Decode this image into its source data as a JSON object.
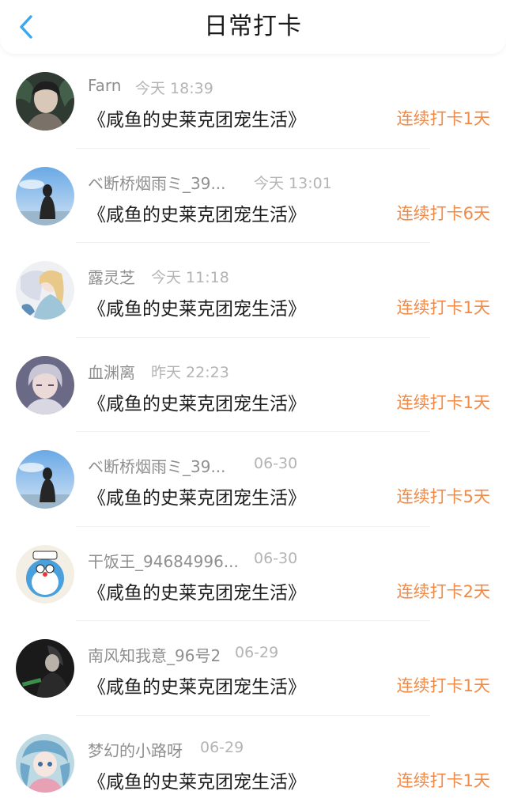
{
  "header": {
    "title": "日常打卡",
    "back_icon": "chevron-left-icon",
    "accent_color": "#3aa8ee"
  },
  "colors": {
    "streak": "#f08a46",
    "name": "#8f8f8f",
    "time": "#b4b4b4"
  },
  "checkins": [
    {
      "name": "Farn",
      "time": "今天 18:39",
      "book": "《咸鱼的史莱克团宠生活》",
      "streak": "连续打卡1天"
    },
    {
      "name": "ベ断桥烟雨ミ_39...",
      "time": "今天 13:01",
      "book": "《咸鱼的史莱克团宠生活》",
      "streak": "连续打卡6天"
    },
    {
      "name": "露灵芝",
      "time": "今天 11:18",
      "book": "《咸鱼的史莱克团宠生活》",
      "streak": "连续打卡1天"
    },
    {
      "name": "血渊离",
      "time": "昨天 22:23",
      "book": "《咸鱼的史莱克团宠生活》",
      "streak": "连续打卡1天"
    },
    {
      "name": "ベ断桥烟雨ミ_39...",
      "time": "06-30",
      "book": "《咸鱼的史莱克团宠生活》",
      "streak": "连续打卡5天"
    },
    {
      "name": "干饭王_94684996...",
      "time": "06-30",
      "book": "《咸鱼的史莱克团宠生活》",
      "streak": "连续打卡2天"
    },
    {
      "name": "南风知我意_96号2",
      "time": "06-29",
      "book": "《咸鱼的史莱克团宠生活》",
      "streak": "连续打卡1天"
    },
    {
      "name": "梦幻的小路呀",
      "time": "06-29",
      "book": "《咸鱼的史莱克团宠生活》",
      "streak": "连续打卡1天"
    }
  ]
}
